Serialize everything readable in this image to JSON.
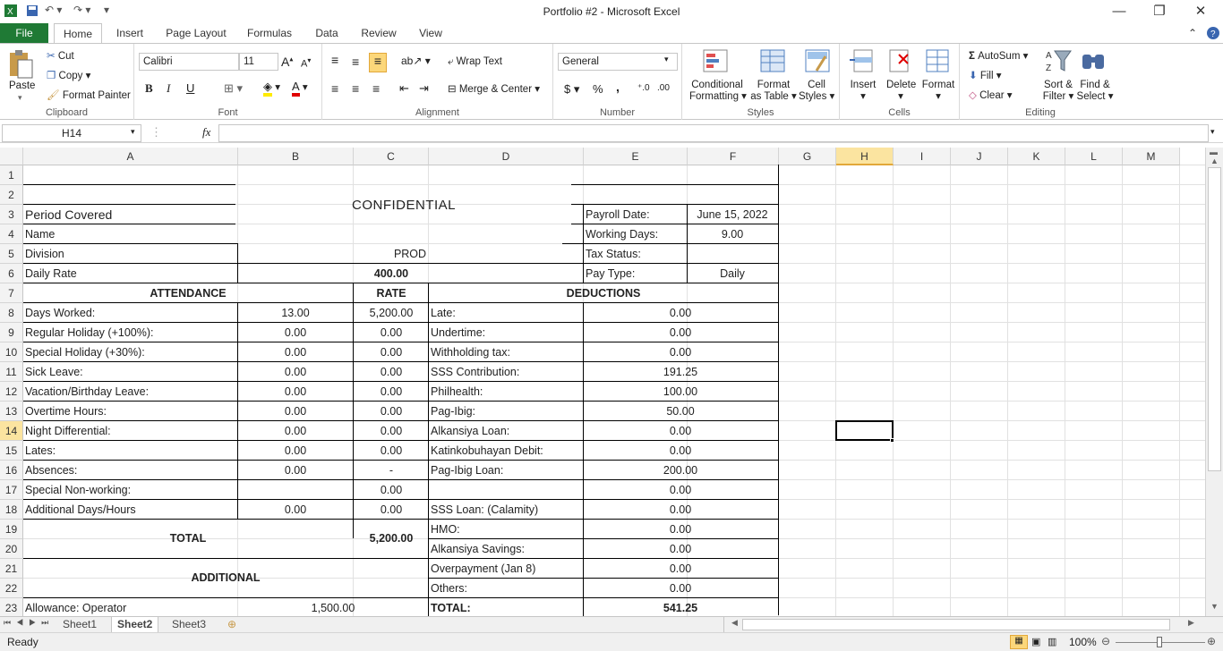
{
  "window": {
    "title": "Portfolio #2  -  Microsoft Excel"
  },
  "tabs": [
    "File",
    "Home",
    "Insert",
    "Page Layout",
    "Formulas",
    "Data",
    "Review",
    "View"
  ],
  "ribbon": {
    "clipboard": {
      "paste": "Paste",
      "cut": "Cut",
      "copy": "Copy",
      "format_painter": "Format Painter",
      "label": "Clipboard"
    },
    "font": {
      "name": "Calibri",
      "size": "11",
      "label": "Font",
      "bold": "B",
      "italic": "I",
      "underline": "U"
    },
    "alignment": {
      "wrap": "Wrap Text",
      "merge": "Merge & Center",
      "label": "Alignment"
    },
    "number": {
      "format": "General",
      "currency": "$",
      "percent": "%",
      "comma": ",",
      "label": "Number"
    },
    "styles": {
      "cond": "Conditional",
      "cond2": "Formatting",
      "table": "Format",
      "table2": "as Table",
      "cell": "Cell",
      "cell2": "Styles",
      "label": "Styles"
    },
    "cells": {
      "insert": "Insert",
      "delete": "Delete",
      "format": "Format",
      "label": "Cells"
    },
    "editing": {
      "autosum": "AutoSum",
      "fill": "Fill",
      "clear": "Clear",
      "sort": "Sort &",
      "sort2": "Filter",
      "find": "Find &",
      "find2": "Select",
      "label": "Editing"
    }
  },
  "formula_bar": {
    "name_box": "H14",
    "fx": "fx",
    "content": ""
  },
  "columns": [
    "A",
    "B",
    "C",
    "D",
    "E",
    "F",
    "G",
    "H",
    "I",
    "J",
    "K",
    "L",
    "M"
  ],
  "rows": [
    "1",
    "2",
    "3",
    "4",
    "5",
    "6",
    "7",
    "8",
    "9",
    "10",
    "11",
    "12",
    "13",
    "14",
    "15",
    "16",
    "17",
    "18",
    "19",
    "20",
    "21",
    "22",
    "23"
  ],
  "sheet": {
    "confidential": "CONFIDENTIAL",
    "period_covered": "Period Covered",
    "name": "Name",
    "division": "Division",
    "division_val": "PROD",
    "daily_rate": "Daily Rate",
    "daily_rate_val": "400.00",
    "payroll_date": "Payroll Date:",
    "payroll_date_val": "June 15, 2022",
    "working_days": "Working Days:",
    "working_days_val": "9.00",
    "tax_status": "Tax Status:",
    "pay_type": "Pay Type:",
    "pay_type_val": "Daily",
    "attendance": "ATTENDANCE",
    "rate": "RATE",
    "deductions": "DEDUCTIONS",
    "att_rows": [
      {
        "label": "Days Worked:",
        "b": "13.00",
        "c": "5,200.00"
      },
      {
        "label": "Regular Holiday (+100%):",
        "b": "0.00",
        "c": "0.00"
      },
      {
        "label": "Special Holiday (+30%):",
        "b": "0.00",
        "c": "0.00"
      },
      {
        "label": "Sick Leave:",
        "b": "0.00",
        "c": "0.00"
      },
      {
        "label": "Vacation/Birthday Leave:",
        "b": "0.00",
        "c": "0.00"
      },
      {
        "label": "Overtime Hours:",
        "b": "0.00",
        "c": "0.00"
      },
      {
        "label": "Night Differential:",
        "b": "0.00",
        "c": "0.00"
      },
      {
        "label": "Lates:",
        "b": "0.00",
        "c": "0.00"
      },
      {
        "label": "Absences:",
        "b": "0.00",
        "c": "-"
      },
      {
        "label": "Special Non-working:",
        "b": "",
        "c": "0.00"
      },
      {
        "label": "Additional Days/Hours",
        "b": "0.00",
        "c": "0.00"
      }
    ],
    "ded_rows": [
      {
        "label": "Late:",
        "val": "0.00"
      },
      {
        "label": "Undertime:",
        "val": "0.00"
      },
      {
        "label": "Withholding tax:",
        "val": "0.00"
      },
      {
        "label": "SSS Contribution:",
        "val": "191.25"
      },
      {
        "label": "Philhealth:",
        "val": "100.00"
      },
      {
        "label": "Pag-Ibig:",
        "val": "50.00"
      },
      {
        "label": "Alkansiya Loan:",
        "val": "0.00"
      },
      {
        "label": "Katinkobuhayan Debit:",
        "val": "0.00"
      },
      {
        "label": "Pag-Ibig Loan:",
        "val": "200.00"
      },
      {
        "label": "",
        "val": "0.00"
      },
      {
        "label": "SSS Loan: (Calamity)",
        "val": "0.00"
      },
      {
        "label": "HMO:",
        "val": "0.00"
      },
      {
        "label": "Alkansiya Savings:",
        "val": "0.00"
      },
      {
        "label": "Overpayment (Jan 8)",
        "val": "0.00"
      },
      {
        "label": "Others:",
        "val": "0.00"
      },
      {
        "label": "TOTAL:",
        "val": "541.25"
      }
    ],
    "total": "TOTAL",
    "total_val": "5,200.00",
    "additional": "ADDITIONAL",
    "allowance": "Allowance: Operator",
    "allowance_val": "1,500.00"
  },
  "sheet_tabs": [
    "Sheet1",
    "Sheet2",
    "Sheet3"
  ],
  "status": {
    "ready": "Ready",
    "zoom": "100%"
  }
}
